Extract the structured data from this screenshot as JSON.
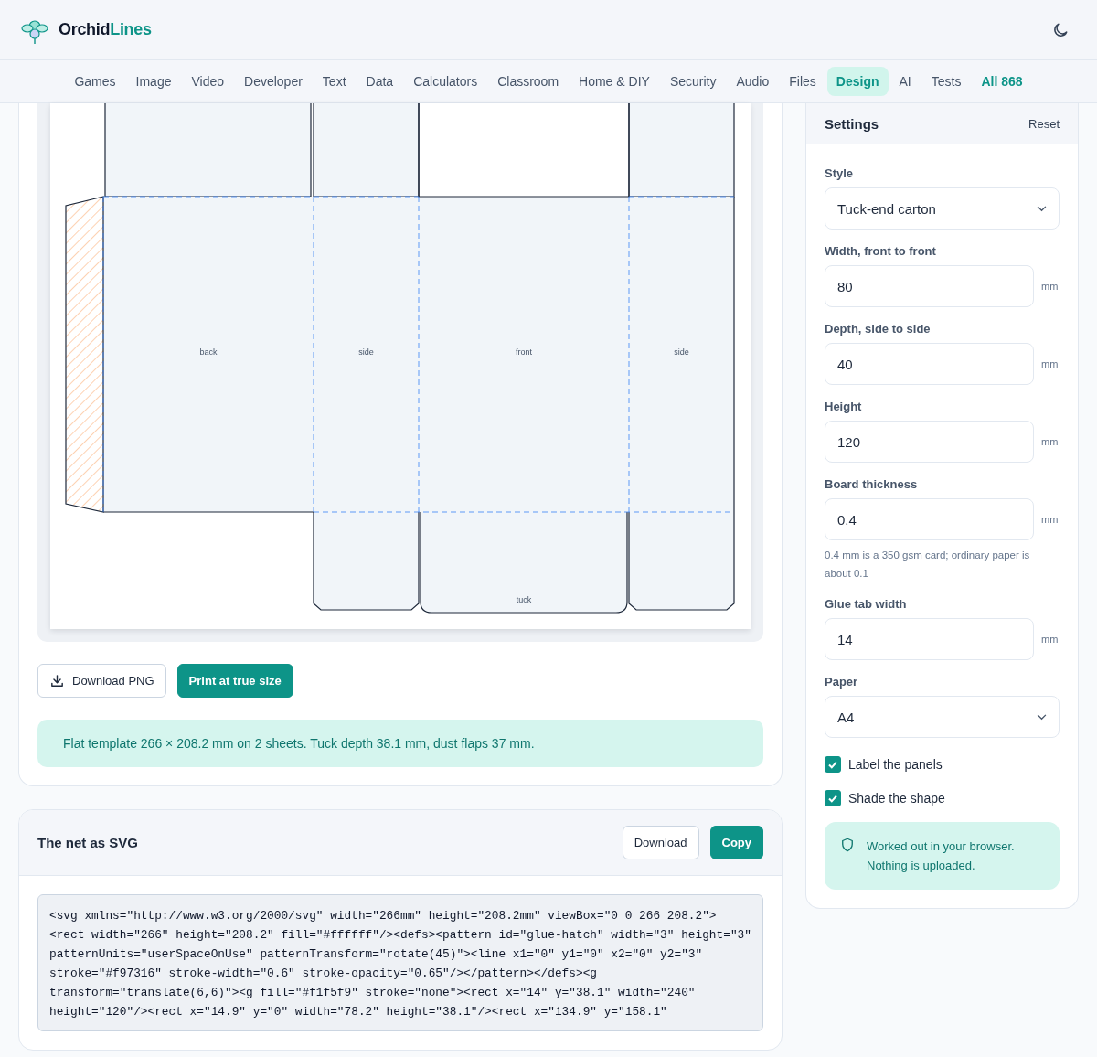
{
  "brand": {
    "first": "Orchid",
    "second": "Lines"
  },
  "nav": [
    {
      "label": "Games",
      "kind": "category",
      "selected": false
    },
    {
      "label": "Image",
      "kind": "category",
      "selected": false
    },
    {
      "label": "Video",
      "kind": "category",
      "selected": false
    },
    {
      "label": "Developer",
      "kind": "category",
      "selected": false
    },
    {
      "label": "Text",
      "kind": "category",
      "selected": false
    },
    {
      "label": "Data",
      "kind": "category",
      "selected": false
    },
    {
      "label": "Calculators",
      "kind": "category",
      "selected": false
    },
    {
      "label": "Classroom",
      "kind": "category",
      "selected": false
    },
    {
      "label": "Home & DIY",
      "kind": "category",
      "selected": false
    },
    {
      "label": "Security",
      "kind": "category",
      "selected": false
    },
    {
      "label": "Audio",
      "kind": "category",
      "selected": false
    },
    {
      "label": "Files",
      "kind": "category",
      "selected": false
    },
    {
      "label": "Design",
      "kind": "category",
      "selected": true
    },
    {
      "label": "AI",
      "kind": "category",
      "selected": false
    },
    {
      "label": "Tests",
      "kind": "category",
      "selected": false
    },
    {
      "label": "All 868",
      "kind": "all",
      "selected": false
    }
  ],
  "preview": {
    "panel_labels": [
      "back",
      "side",
      "front",
      "side"
    ],
    "tuck_label": "tuck"
  },
  "actions": [
    {
      "label": "Download PNG",
      "kind": "outline"
    },
    {
      "label": "Print at true size",
      "kind": "primary"
    }
  ],
  "summary": "Flat template 266 × 208.2 mm on 2 sheets. Tuck depth 38.1 mm, dust flaps 37 mm.",
  "svg_card": {
    "title": "The net as SVG",
    "buttons": [
      {
        "label": "Download",
        "kind": "outline"
      },
      {
        "label": "Copy",
        "kind": "primary"
      }
    ],
    "code": "<svg xmlns=\"http://www.w3.org/2000/svg\" width=\"266mm\" height=\"208.2mm\" viewBox=\"0 0 266 208.2\">\n<rect width=\"266\" height=\"208.2\" fill=\"#ffffff\"/><defs><pattern id=\"glue-hatch\" width=\"3\" height=\"3\" patternUnits=\"userSpaceOnUse\" patternTransform=\"rotate(45)\"><line x1=\"0\" y1=\"0\" x2=\"0\" y2=\"3\" stroke=\"#f97316\" stroke-width=\"0.6\" stroke-opacity=\"0.65\"/></pattern></defs><g transform=\"translate(6,6)\"><g fill=\"#f1f5f9\" stroke=\"none\"><rect x=\"14\" y=\"38.1\" width=\"240\" height=\"120\"/><rect x=\"14.9\" y=\"0\" width=\"78.2\" height=\"38.1\"/><rect x=\"134.9\" y=\"158.1\""
  },
  "settings": {
    "title": "Settings",
    "reset": "Reset",
    "fields": [
      {
        "kind": "select",
        "label": "Style",
        "value": "Tuck-end carton"
      },
      {
        "kind": "number",
        "label": "Width, front to front",
        "value": "80",
        "unit": "mm"
      },
      {
        "kind": "number",
        "label": "Depth, side to side",
        "value": "40",
        "unit": "mm"
      },
      {
        "kind": "number",
        "label": "Height",
        "value": "120",
        "unit": "mm"
      },
      {
        "kind": "number",
        "label": "Board thickness",
        "value": "0.4",
        "unit": "mm",
        "hint": "0.4 mm is a 350 gsm card; ordinary paper is about 0.1"
      },
      {
        "kind": "number",
        "label": "Glue tab width",
        "value": "14",
        "unit": "mm"
      },
      {
        "kind": "select",
        "label": "Paper",
        "value": "A4"
      }
    ],
    "checkboxes": [
      {
        "label": "Label the panels",
        "checked": true
      },
      {
        "label": "Shade the shape",
        "checked": true
      }
    ],
    "notice": "Worked out in your browser. Nothing is uploaded."
  }
}
